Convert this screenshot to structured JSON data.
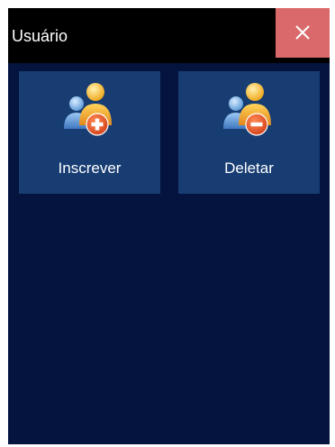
{
  "window": {
    "title": "Usuário",
    "close_icon": "close-icon"
  },
  "tiles": [
    {
      "label": "Inscrever",
      "icon": "add-user-icon"
    },
    {
      "label": "Deletar",
      "icon": "delete-user-icon"
    }
  ],
  "colors": {
    "background": "#04143f",
    "titlebar": "#000000",
    "close_button": "#d9696a",
    "tile": "#173d73",
    "text": "#ffffff",
    "badge": "#e2541f"
  }
}
